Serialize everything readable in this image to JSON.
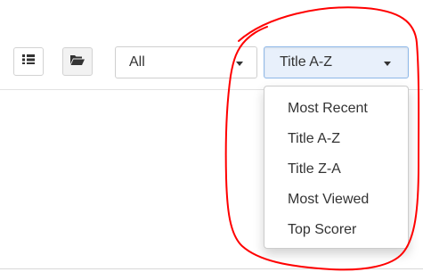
{
  "toolbar": {
    "list_view_icon": "list-icon",
    "folder_view_icon": "folder-open-icon",
    "filter": {
      "selected": "All"
    },
    "sort": {
      "selected": "Title A-Z",
      "options": [
        "Most Recent",
        "Title A-Z",
        "Title Z-A",
        "Most Viewed",
        "Top Scorer"
      ]
    }
  },
  "colors": {
    "annotation": "#ff0000",
    "sort_active_bg": "#e8f0fb",
    "sort_active_border": "#8eb8e8",
    "text": "#333333"
  }
}
